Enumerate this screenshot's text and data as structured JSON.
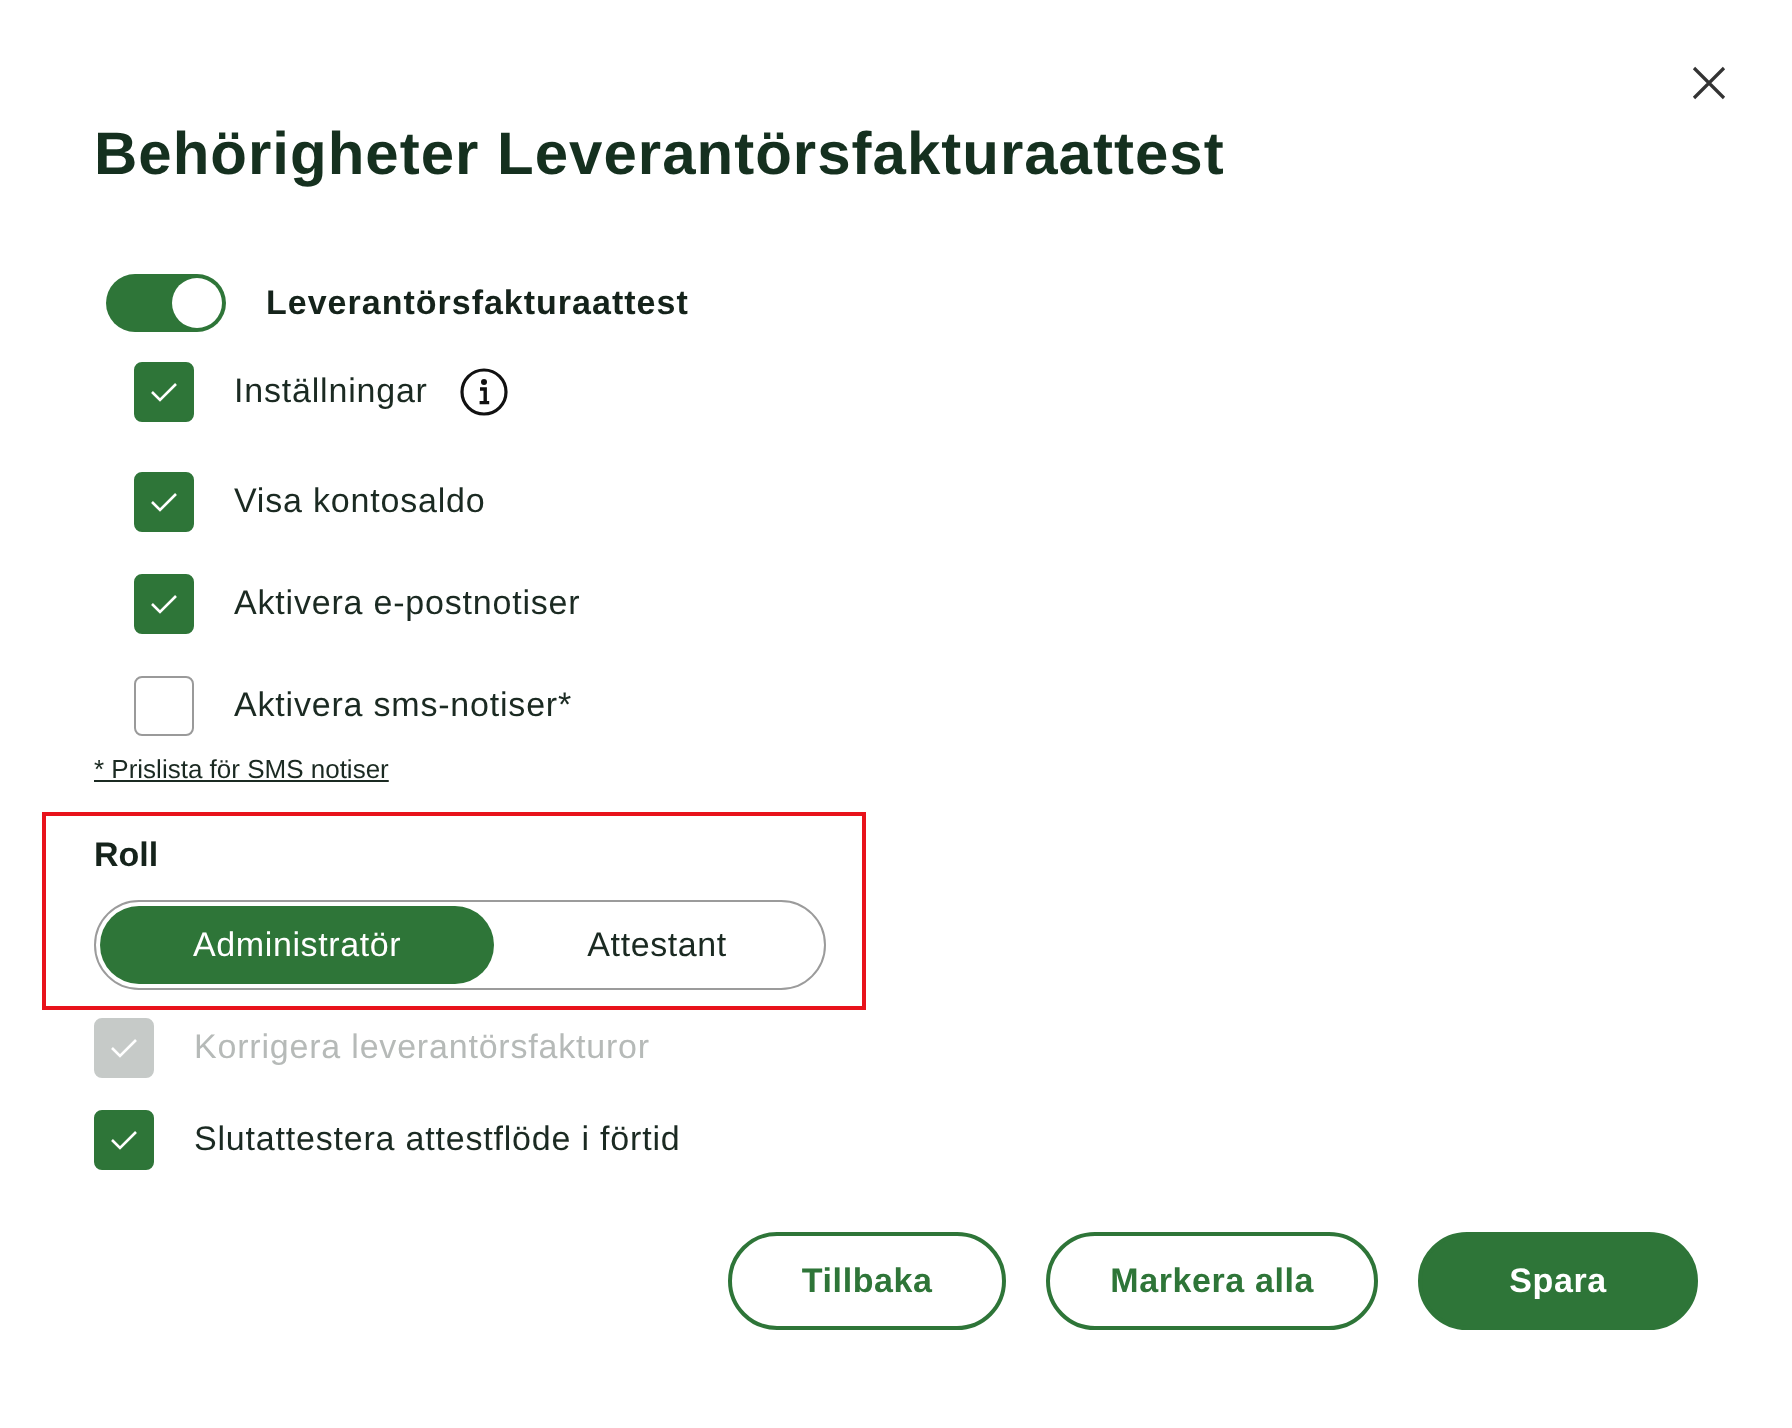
{
  "dialog": {
    "title": "Behörigheter Leverantörsfakturaattest"
  },
  "module_toggle": {
    "label": "Leverantörsfakturaattest",
    "on": true
  },
  "permissions": [
    {
      "label": "Inställningar",
      "checked": true,
      "info": true
    },
    {
      "label": "Visa kontosaldo",
      "checked": true,
      "info": false
    },
    {
      "label": "Aktivera e-postnotiser",
      "checked": true,
      "info": false
    },
    {
      "label": "Aktivera sms-notiser*",
      "checked": false,
      "info": false
    }
  ],
  "price_list_link": "* Prislista för SMS notiser",
  "role": {
    "label": "Roll",
    "highlighted": true,
    "options": [
      {
        "label": "Administratör",
        "selected": true
      },
      {
        "label": "Attestant",
        "selected": false
      }
    ]
  },
  "role_permissions": [
    {
      "label": "Korrigera leverantörsfakturor",
      "checked": true,
      "disabled": true
    },
    {
      "label": "Slutattestera attestflöde i förtid",
      "checked": true,
      "disabled": false
    }
  ],
  "buttons": [
    {
      "label": "Tillbaka",
      "kind": "secondary"
    },
    {
      "label": "Markera alla",
      "kind": "secondary"
    },
    {
      "label": "Spara",
      "kind": "primary"
    }
  ]
}
